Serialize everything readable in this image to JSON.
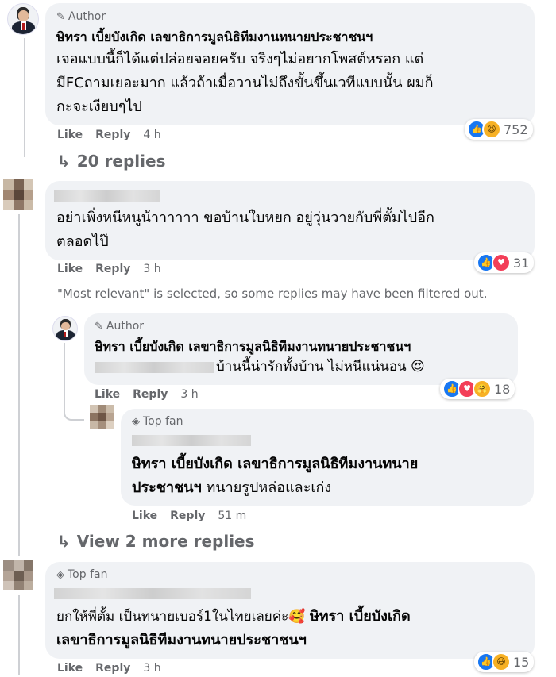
{
  "comments": [
    {
      "badge": "Author",
      "name": "ษิทรา เบี้ยบังเกิด เลขาธิการมูลนิธิทีมงานทนายประชาชนฯ",
      "lines": [
        "เจอแบบนี้ก็ได้แต่ปล่อยจอยครับ จริงๆไม่อยากโพสต์หรอก แต่",
        "มีFCถามเยอะมาก แล้วถ้าเมื่อวานไม่ถึงขั้นขึ้นเวทีแบบนั้น ผมก็",
        "กะจะเงียบๆไป"
      ],
      "like": "Like",
      "reply": "Reply",
      "time": "4 h",
      "reactions": {
        "count": "752",
        "types": [
          "like",
          "haha"
        ]
      },
      "replies_link": "20 replies"
    },
    {
      "lines": [
        "อย่าเพิ่งหนีหนูน้าาาาาา ขอบ้านใบหยก อยู่วุ่นวายกับพี่ตั้มไปอีก",
        "ตลอดไป๊"
      ],
      "like": "Like",
      "reply": "Reply",
      "time": "3 h",
      "reactions": {
        "count": "31",
        "types": [
          "like",
          "love"
        ]
      },
      "notice": "\"Most relevant\" is selected, so some replies may have been filtered out.",
      "replies": [
        {
          "badge": "Author",
          "name": "ษิทรา เบี้ยบังเกิด เลขาธิการมูลนิธิทีมงานทนายประชาชนฯ",
          "text": "บ้านนี้น่ารักทั้งบ้าน ไม่หนีแน่นอน 😍",
          "like": "Like",
          "reply": "Reply",
          "time": "3 h",
          "reactions": {
            "count": "18",
            "types": [
              "like",
              "love",
              "care"
            ]
          }
        },
        {
          "badge": "Top fan",
          "mention_lines": [
            "ษิทรา เบี้ยบังเกิด เลขาธิการมูลนิธิทีมงานทนาย",
            "ประชาชนฯ"
          ],
          "text": "ทนายรูปหล่อและเก่ง",
          "like": "Like",
          "reply": "Reply",
          "time": "51 m"
        }
      ],
      "more_link": "View 2 more replies"
    },
    {
      "badge": "Top fan",
      "text_line1": "ยกให้พี่ตั้ม เป็นทนายเบอร์1ในไทยเลยค่ะ🥰",
      "mention_line1": "ษิทรา เบี้ยบังเกิด",
      "mention_line2": "เลขาธิการมูลนิธิทีมงานทนายประชาชนฯ",
      "like": "Like",
      "reply": "Reply",
      "time": "3 h",
      "reactions": {
        "count": "15",
        "types": [
          "like",
          "haha"
        ]
      }
    }
  ],
  "colors": {
    "bubble": "#f0f2f5",
    "meta": "#65676b",
    "like": "#1877f2",
    "love": "#f33e58",
    "haha": "#f7b125"
  }
}
